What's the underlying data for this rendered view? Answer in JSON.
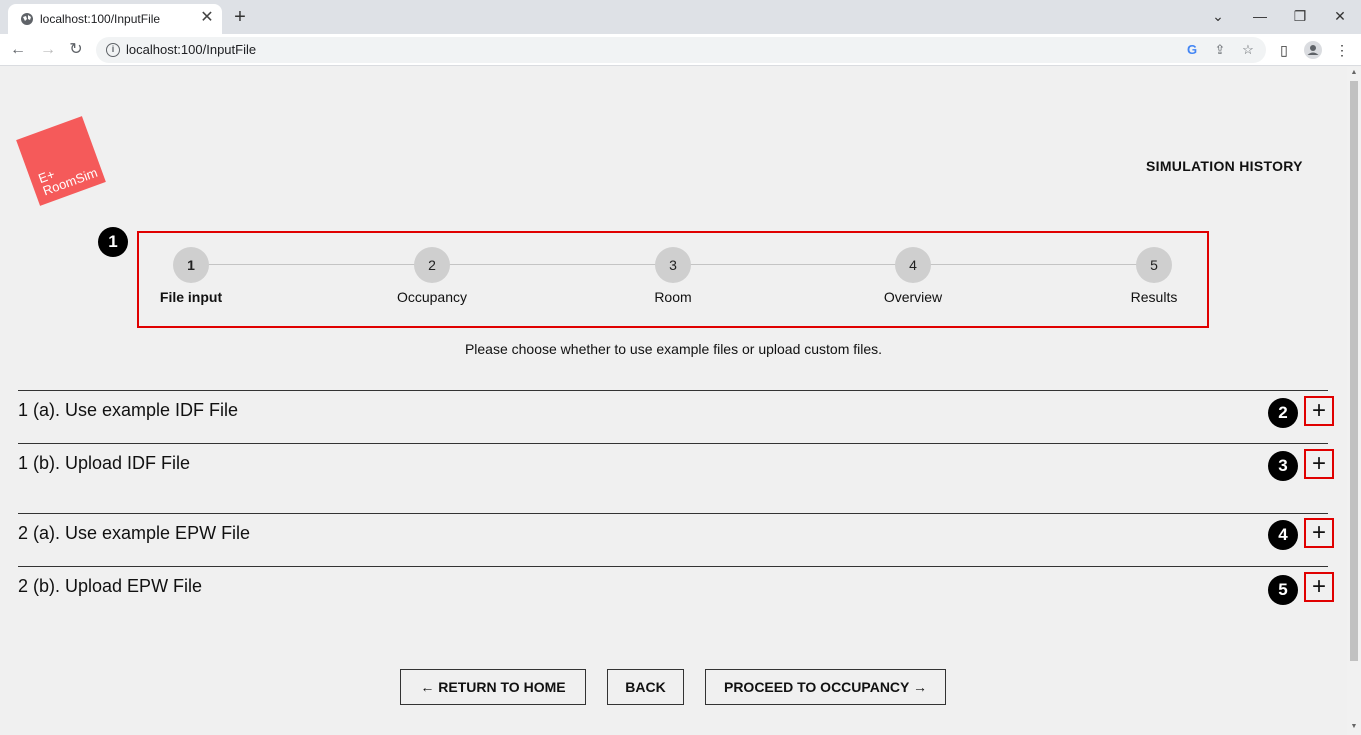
{
  "browser": {
    "tab_title": "localhost:100/InputFile",
    "tab_close": "✕",
    "new_tab": "+",
    "url": "localhost:100/InputFile",
    "window_controls": [
      "⌄",
      "—",
      "❐",
      "✕"
    ]
  },
  "header": {
    "logo_line1": "E+",
    "logo_line2": "RoomSim",
    "history_link": "SIMULATION HISTORY"
  },
  "stepper": {
    "steps": [
      {
        "number": "1",
        "label": "File input"
      },
      {
        "number": "2",
        "label": "Occupancy"
      },
      {
        "number": "3",
        "label": "Room"
      },
      {
        "number": "4",
        "label": "Overview"
      },
      {
        "number": "5",
        "label": "Results"
      }
    ],
    "active_step": 1
  },
  "badges": [
    "1",
    "2",
    "3",
    "4",
    "5"
  ],
  "instruction": "Please choose whether to use example files or upload custom files.",
  "accordion": [
    {
      "title": "1 (a). Use example IDF File",
      "toggle": "+"
    },
    {
      "title": "1 (b). Upload IDF File",
      "toggle": "+"
    },
    {
      "title": "2 (a). Use example EPW File",
      "toggle": "+"
    },
    {
      "title": "2 (b). Upload EPW File",
      "toggle": "+"
    }
  ],
  "buttons": {
    "home": "← RETURN TO HOME",
    "back": "BACK",
    "proceed": "PROCEED TO OCCUPANCY →"
  },
  "colors": {
    "logo": "#f55a5a",
    "highlight": "#e00000"
  }
}
